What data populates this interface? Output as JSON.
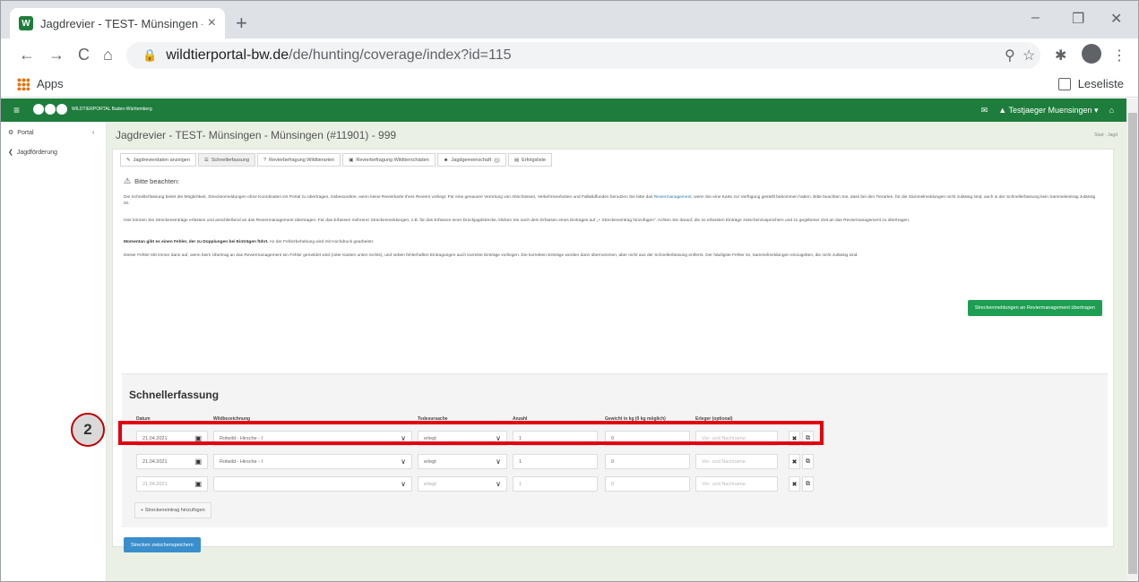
{
  "browser": {
    "tab_title": "Jagdrevier - TEST- Münsingen - M",
    "tab_close": "×",
    "new_tab": "+",
    "url_host": "wildtierportal-bw.de",
    "url_path": "/de/hunting/coverage/index?id=115",
    "bookmarks": {
      "apps": "Apps",
      "reading_list": "Leseliste"
    },
    "window_controls": {
      "minimize": "–",
      "restore": "❐",
      "close": "✕"
    },
    "nav": {
      "back": "←",
      "forward": "→",
      "reload": "C",
      "home": "⌂"
    }
  },
  "appbar": {
    "menu_icon": "≡",
    "logo_text": "WILDTIERPORTAL Baden-Württemberg",
    "mail_icon": "✉",
    "user": "▲ Testjaeger Muensingen ▾",
    "home_icon": "⌂"
  },
  "sidebar": {
    "items": [
      {
        "label": "Portal",
        "icon": "gear-icon"
      },
      {
        "label": "Jagdförderung",
        "icon": "chevron-left-icon"
      }
    ]
  },
  "page": {
    "title": "Jagdrevier - TEST- Münsingen - Münsingen (#11901) - 999",
    "breadcrumb": "Start · Jagd"
  },
  "tabs": [
    {
      "label": "Jagdrevierdaten anzeigen"
    },
    {
      "label": "Schnellerfassung"
    },
    {
      "label": "Revierbefragung Wildtierarten"
    },
    {
      "label": "Revierbefragung Wildtierschäden"
    },
    {
      "label": "Jagdgemeinschaft",
      "badge": "3"
    },
    {
      "label": "Erfolgsliste"
    }
  ],
  "notice": {
    "title": "Bitte beachten:",
    "p1_a": "Die Schnellerfassung bietet die Möglichkeit, Streckenmeldungen ohne Koordinaten ins Portal zu übertragen, insbesondere, wenn keine Revierkarte Ihres Reviers vorliegt. Für eine genauere Verortung von Abschüssen, Verkehrsverlusten und Fallwildfunden benutzen Sie bitte das ",
    "p1_link": "Reviermanagement",
    "p1_b": ", wenn Sie eine Karte zur Verfügung gestellt bekommen haben. Bitte beachten Sie, dass bei den Tierarten, für die Sammelmeldungen nicht zulässig sind, auch in der Schnellerfassung kein Sammeleintrag zulässig ist.",
    "p2": "Hier können Sie Streckeneinträge erfassen und anschließend an das Reviermanagement übertragen. Für das Erfassen mehrerer Streckenmeldungen, z.B. für das Erfassen einer Drückjagdstrecke, klicken Sie nach dem Erfassen eines Eintrages auf „+ Streckeneintrag hinzufügen\". Achten Sie darauf, die so erfassten Einträge zwischenzuspeichern und zu gegebener Zeit an das Reviermanagement zu übertragen.",
    "p3_bold": "Momentan gibt es einen Fehler, der zu Dopplungen bei Einträgen führt.",
    "p3_rest": " An der Fehlerbehebung wird mit Hochdruck gearbeitet.",
    "p4": "Dieser Fehler tritt immer dann auf, wenn beim Übertrag an das Reviermanagement ein Fehler gemeldet wird (roter Kasten unten rechts), und neben fehlerhaften Eintragungen auch korrekte Einträge vorliegen. Die korrekten Einträge werden dann übernommen, aber nicht aus der Schnellerfassung entfernt. Der häufigste Fehler ist, Sammelmeldungen einzugeben, die nicht zulässig sind."
  },
  "transfer_button": "Streckenmeldungen an Reviermanagement übertragen",
  "quick_entry": {
    "heading": "Schnellerfassung",
    "columns": {
      "date": "Datum",
      "species": "Wildbezeichnung",
      "cause": "Todesursache",
      "count": "Anzahl",
      "weight": "Gewicht in kg (0 kg möglich)",
      "hunter": "Erleger (optional)"
    },
    "rows": [
      {
        "date": "21.04.2021",
        "species": "Rotwild - Hirsche - I",
        "cause": "erlegt",
        "count": "1",
        "weight": "0",
        "hunter_placeholder": "Vor- und Nachname"
      },
      {
        "date": "21.04.2021",
        "species": "Rotwild - Hirsche - I",
        "cause": "erlegt",
        "count": "1",
        "weight": "0",
        "hunter_placeholder": "Vor- und Nachname"
      },
      {
        "date": "21.04.2021",
        "species": "",
        "cause": "erlegt",
        "count": "1",
        "weight": "0",
        "hunter_placeholder": "Vor- und Nachname"
      }
    ],
    "add_button": "+ Streckeneintrag hinzufügen",
    "save_button": "Strecken zwischenspeichern"
  },
  "annotation": {
    "step_number": "2",
    "highlight_color": "#e3000f"
  },
  "colors": {
    "brand_green": "#1e7d3c",
    "button_green": "#1e9e52",
    "button_blue": "#3a8ecb"
  }
}
